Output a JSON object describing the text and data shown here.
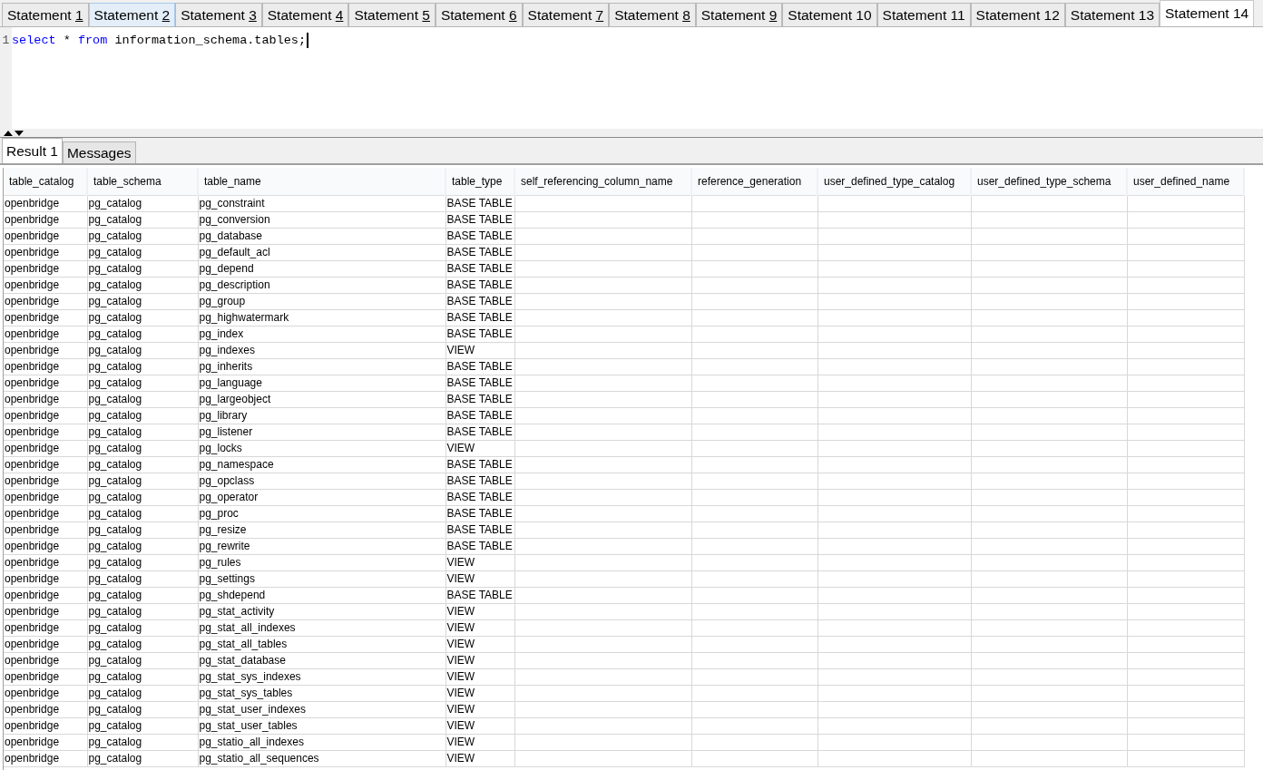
{
  "statement_tabs": [
    {
      "label": "Statement ",
      "accel": "1",
      "selected": false,
      "hovered": false
    },
    {
      "label": "Statement ",
      "accel": "2",
      "selected": false,
      "hovered": true
    },
    {
      "label": "Statement ",
      "accel": "3",
      "selected": false,
      "hovered": false
    },
    {
      "label": "Statement ",
      "accel": "4",
      "selected": false,
      "hovered": false
    },
    {
      "label": "Statement ",
      "accel": "5",
      "selected": false,
      "hovered": false
    },
    {
      "label": "Statement ",
      "accel": "6",
      "selected": false,
      "hovered": false
    },
    {
      "label": "Statement ",
      "accel": "7",
      "selected": false,
      "hovered": false
    },
    {
      "label": "Statement ",
      "accel": "8",
      "selected": false,
      "hovered": false
    },
    {
      "label": "Statement ",
      "accel": "9",
      "selected": false,
      "hovered": false
    },
    {
      "label": "Statement 10",
      "selected": false,
      "hovered": false
    },
    {
      "label": "Statement 11",
      "selected": false,
      "hovered": false
    },
    {
      "label": "Statement 12",
      "selected": false,
      "hovered": false
    },
    {
      "label": "Statement 13",
      "selected": false,
      "hovered": false
    },
    {
      "label": "Statement 14",
      "selected": true,
      "hovered": false
    }
  ],
  "editor": {
    "lines": [
      {
        "number": "1",
        "tokens": [
          {
            "text": "select",
            "kind": "keyword"
          },
          {
            "text": " * ",
            "kind": "plain"
          },
          {
            "text": "from",
            "kind": "keyword"
          },
          {
            "text": " information_schema.tables;",
            "kind": "plain"
          }
        ]
      }
    ]
  },
  "result_tabs": [
    {
      "label": "Result 1",
      "selected": true
    },
    {
      "label": "Messages",
      "selected": false
    }
  ],
  "table": {
    "columns": [
      "table_catalog",
      "table_schema",
      "table_name",
      "table_type",
      "self_referencing_column_name",
      "reference_generation",
      "user_defined_type_catalog",
      "user_defined_type_schema",
      "user_defined_name"
    ],
    "rows": [
      [
        "openbridge",
        "pg_catalog",
        "pg_constraint",
        "BASE TABLE"
      ],
      [
        "openbridge",
        "pg_catalog",
        "pg_conversion",
        "BASE TABLE"
      ],
      [
        "openbridge",
        "pg_catalog",
        "pg_database",
        "BASE TABLE"
      ],
      [
        "openbridge",
        "pg_catalog",
        "pg_default_acl",
        "BASE TABLE"
      ],
      [
        "openbridge",
        "pg_catalog",
        "pg_depend",
        "BASE TABLE"
      ],
      [
        "openbridge",
        "pg_catalog",
        "pg_description",
        "BASE TABLE"
      ],
      [
        "openbridge",
        "pg_catalog",
        "pg_group",
        "BASE TABLE"
      ],
      [
        "openbridge",
        "pg_catalog",
        "pg_highwatermark",
        "BASE TABLE"
      ],
      [
        "openbridge",
        "pg_catalog",
        "pg_index",
        "BASE TABLE"
      ],
      [
        "openbridge",
        "pg_catalog",
        "pg_indexes",
        "VIEW"
      ],
      [
        "openbridge",
        "pg_catalog",
        "pg_inherits",
        "BASE TABLE"
      ],
      [
        "openbridge",
        "pg_catalog",
        "pg_language",
        "BASE TABLE"
      ],
      [
        "openbridge",
        "pg_catalog",
        "pg_largeobject",
        "BASE TABLE"
      ],
      [
        "openbridge",
        "pg_catalog",
        "pg_library",
        "BASE TABLE"
      ],
      [
        "openbridge",
        "pg_catalog",
        "pg_listener",
        "BASE TABLE"
      ],
      [
        "openbridge",
        "pg_catalog",
        "pg_locks",
        "VIEW"
      ],
      [
        "openbridge",
        "pg_catalog",
        "pg_namespace",
        "BASE TABLE"
      ],
      [
        "openbridge",
        "pg_catalog",
        "pg_opclass",
        "BASE TABLE"
      ],
      [
        "openbridge",
        "pg_catalog",
        "pg_operator",
        "BASE TABLE"
      ],
      [
        "openbridge",
        "pg_catalog",
        "pg_proc",
        "BASE TABLE"
      ],
      [
        "openbridge",
        "pg_catalog",
        "pg_resize",
        "BASE TABLE"
      ],
      [
        "openbridge",
        "pg_catalog",
        "pg_rewrite",
        "BASE TABLE"
      ],
      [
        "openbridge",
        "pg_catalog",
        "pg_rules",
        "VIEW"
      ],
      [
        "openbridge",
        "pg_catalog",
        "pg_settings",
        "VIEW"
      ],
      [
        "openbridge",
        "pg_catalog",
        "pg_shdepend",
        "BASE TABLE"
      ],
      [
        "openbridge",
        "pg_catalog",
        "pg_stat_activity",
        "VIEW"
      ],
      [
        "openbridge",
        "pg_catalog",
        "pg_stat_all_indexes",
        "VIEW"
      ],
      [
        "openbridge",
        "pg_catalog",
        "pg_stat_all_tables",
        "VIEW"
      ],
      [
        "openbridge",
        "pg_catalog",
        "pg_stat_database",
        "VIEW"
      ],
      [
        "openbridge",
        "pg_catalog",
        "pg_stat_sys_indexes",
        "VIEW"
      ],
      [
        "openbridge",
        "pg_catalog",
        "pg_stat_sys_tables",
        "VIEW"
      ],
      [
        "openbridge",
        "pg_catalog",
        "pg_stat_user_indexes",
        "VIEW"
      ],
      [
        "openbridge",
        "pg_catalog",
        "pg_stat_user_tables",
        "VIEW"
      ],
      [
        "openbridge",
        "pg_catalog",
        "pg_statio_all_indexes",
        "VIEW"
      ],
      [
        "openbridge",
        "pg_catalog",
        "pg_statio_all_sequences",
        "VIEW"
      ]
    ]
  }
}
